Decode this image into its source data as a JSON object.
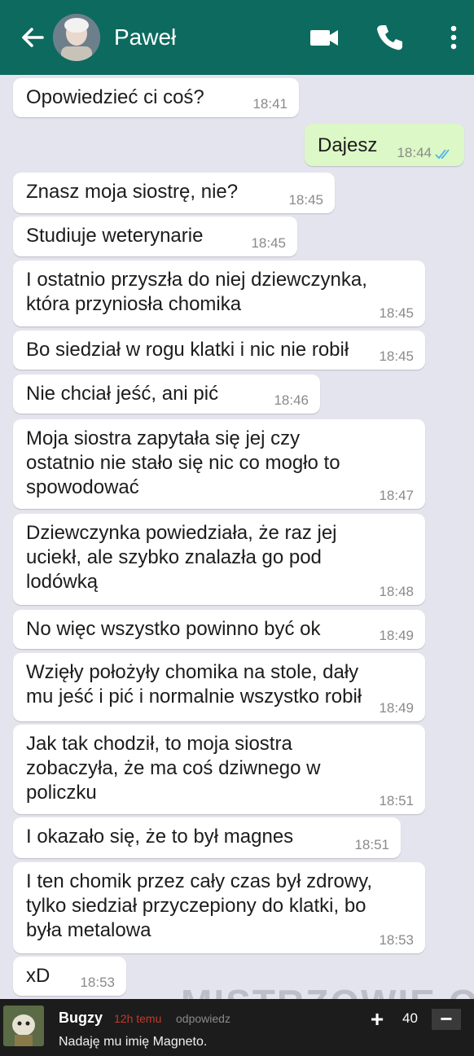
{
  "header": {
    "contact_name": "Paweł",
    "bg_color": "#0d6a5f",
    "icons": [
      "back-arrow-icon",
      "avatar",
      "video-call-icon",
      "phone-icon",
      "more-vert-icon"
    ]
  },
  "messages": [
    {
      "dir": "in",
      "text": "Opowiedzieć ci coś?",
      "time": "18:41"
    },
    {
      "dir": "out",
      "text": "Dajesz",
      "time": "18:44",
      "status": "read"
    },
    {
      "dir": "in",
      "text": "Znasz moja siostrę, nie?",
      "time": "18:45"
    },
    {
      "dir": "in",
      "text": "Studiuje weterynarie",
      "time": "18:45"
    },
    {
      "dir": "in",
      "text": "I ostatnio przyszła do niej dziewczynka,\nktóra przyniosła chomika",
      "time": "18:45"
    },
    {
      "dir": "in",
      "text": "Bo siedział w rogu klatki i nic nie robił",
      "time": "18:45"
    },
    {
      "dir": "in",
      "text": "Nie chciał jeść, ani pić",
      "time": "18:46"
    },
    {
      "dir": "in",
      "text": "Moja siostra zapytała się jej czy\nostatnio nie stało się nic co mogło to\nspowodować",
      "time": "18:47"
    },
    {
      "dir": "in",
      "text": "Dziewczynka powiedziała, że raz jej\nuciekł, ale szybko znalazła go pod\nlodówką",
      "time": "18:48"
    },
    {
      "dir": "in",
      "text": "No więc wszystko powinno być ok",
      "time": "18:49"
    },
    {
      "dir": "in",
      "text": "Wzięły położyły chomika na stole, dały\nmu jeść i pić i normalnie wszystko robił",
      "time": "18:49"
    },
    {
      "dir": "in",
      "text": "Jak tak chodził, to moja siostra\nzobaczyła, że ma coś dziwnego w\npoliczku",
      "time": "18:51"
    },
    {
      "dir": "in",
      "text": "I okazało się, że to był magnes",
      "time": "18:51"
    },
    {
      "dir": "in",
      "text": "I ten chomik przez cały czas był zdrowy,\ntylko siedział przyczepiony do klatki, bo\nbyła metalowa",
      "time": "18:53"
    },
    {
      "dir": "in",
      "text": "xD",
      "time": "18:53"
    }
  ],
  "watermark": "MISTRZOWIE.ORG",
  "comment": {
    "user": "Bugzy",
    "time": "12h temu",
    "reply_label": "odpowiedz",
    "text": "Nadaję mu imię Magneto.",
    "vote_plus": "+",
    "votes": "40",
    "vote_minus": "−",
    "time_color": "#c23a2a"
  }
}
